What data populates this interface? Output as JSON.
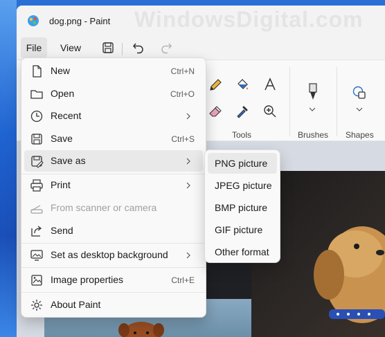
{
  "window": {
    "title": "dog.png - Paint",
    "watermark": "WindowsDigital.com"
  },
  "menubar": {
    "file_label": "File",
    "view_label": "View",
    "icons": [
      "save-icon",
      "undo-icon",
      "redo-icon"
    ]
  },
  "ribbon": {
    "groups": [
      {
        "label": "Tools",
        "icons": [
          "pencil-icon",
          "fill-bucket-icon",
          "text-icon",
          "eraser-icon",
          "color-picker-icon",
          "magnifier-icon"
        ]
      },
      {
        "label": "Brushes",
        "icons": [
          "brush-icon"
        ]
      },
      {
        "label": "Shapes",
        "icons": [
          "shapes-icon"
        ]
      }
    ]
  },
  "file_menu": {
    "items": [
      {
        "label": "New",
        "shortcut": "Ctrl+N",
        "icon": "new-file-icon",
        "enabled": true
      },
      {
        "label": "Open",
        "shortcut": "Ctrl+O",
        "icon": "folder-icon",
        "enabled": true
      },
      {
        "label": "Recent",
        "shortcut": "",
        "icon": "clock-icon",
        "submenu": true,
        "enabled": true
      },
      {
        "label": "Save",
        "shortcut": "Ctrl+S",
        "icon": "save-icon",
        "enabled": true
      },
      {
        "label": "Save as",
        "shortcut": "",
        "icon": "save-as-icon",
        "submenu": true,
        "highlighted": true,
        "enabled": true
      },
      {
        "label": "Print",
        "shortcut": "",
        "icon": "printer-icon",
        "submenu": true,
        "enabled": true
      },
      {
        "label": "From scanner or camera",
        "shortcut": "",
        "icon": "scanner-icon",
        "enabled": false
      },
      {
        "label": "Send",
        "shortcut": "",
        "icon": "share-icon",
        "enabled": true
      },
      {
        "label": "Set as desktop background",
        "shortcut": "",
        "icon": "desktop-icon",
        "submenu": true,
        "enabled": true
      },
      {
        "label": "Image properties",
        "shortcut": "Ctrl+E",
        "icon": "image-properties-icon",
        "enabled": true
      },
      {
        "label": "About Paint",
        "shortcut": "",
        "icon": "gear-icon",
        "enabled": true
      }
    ]
  },
  "save_as_submenu": {
    "items": [
      {
        "label": "PNG picture",
        "highlighted": true
      },
      {
        "label": "JPEG picture"
      },
      {
        "label": "BMP picture"
      },
      {
        "label": "GIF picture"
      },
      {
        "label": "Other format"
      }
    ]
  }
}
